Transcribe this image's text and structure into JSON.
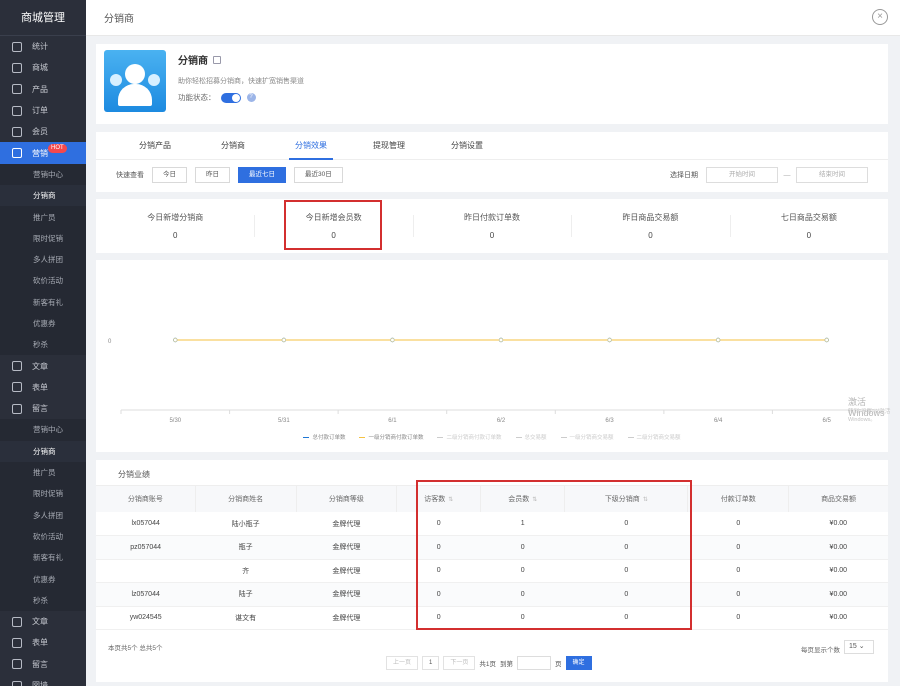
{
  "sidebar": {
    "title": "商城管理",
    "hot_badge": "HOT",
    "top_items": [
      {
        "label": "统计"
      },
      {
        "label": "商城"
      },
      {
        "label": "产品"
      },
      {
        "label": "订单"
      },
      {
        "label": "会员"
      },
      {
        "label": "营销"
      }
    ],
    "sub_items_1": [
      "营销中心",
      "分销商",
      "推广员",
      "限时促销",
      "多人拼团",
      "砍价活动",
      "新客有礼",
      "优惠券",
      "秒杀"
    ],
    "mid_items": [
      {
        "label": "文章"
      },
      {
        "label": "表单"
      },
      {
        "label": "留言"
      }
    ],
    "sub_items_2": [
      "营销中心",
      "分销商",
      "推广员",
      "限时促销",
      "多人拼团",
      "砍价活动",
      "新客有礼",
      "优惠券",
      "秒杀"
    ],
    "bottom_items": [
      {
        "label": "文章"
      },
      {
        "label": "表单"
      },
      {
        "label": "留言"
      },
      {
        "label": "図墙"
      }
    ]
  },
  "modal": {
    "title": "分销商",
    "close_icon": "×"
  },
  "plugin": {
    "name": "分销商",
    "description": "助你轻松招募分销商，快速扩宽销售渠道",
    "status_label": "功能状态：",
    "help": "?"
  },
  "tabs": [
    "分销产品",
    "分销商",
    "分销效果",
    "提现管理",
    "分销设置"
  ],
  "filter": {
    "label": "快速查看",
    "buttons": [
      "今日",
      "昨日",
      "最近七日",
      "最近30日"
    ],
    "date_label": "选择日期",
    "date_start": "开始时间",
    "date_sep": "—",
    "date_end": "结束时间"
  },
  "stats": [
    {
      "label": "今日新增分销商",
      "value": "0"
    },
    {
      "label": "今日新增会员数",
      "value": "0"
    },
    {
      "label": "昨日付款订单数",
      "value": "0"
    },
    {
      "label": "昨日商品交易额",
      "value": "0"
    },
    {
      "label": "七日商品交易额",
      "value": "0"
    }
  ],
  "chart_data": {
    "type": "line",
    "x": [
      "5/30",
      "5/31",
      "6/1",
      "6/2",
      "6/3",
      "6/4",
      "6/5"
    ],
    "y_tick": "0",
    "ylim": [
      0,
      1
    ],
    "grid": false,
    "legend_position": "bottom",
    "series": [
      {
        "name": "总付款订单数",
        "values": [
          0,
          0,
          0,
          0,
          0,
          0,
          0
        ],
        "color": "#1f77d4",
        "active": true
      },
      {
        "name": "一级分销商付款订单数",
        "values": [
          0,
          0,
          0,
          0,
          0,
          0,
          0
        ],
        "color": "#f5c242",
        "active": true
      },
      {
        "name": "二级分销商付款订单数",
        "values": [
          0,
          0,
          0,
          0,
          0,
          0,
          0
        ],
        "color": "#cccccc",
        "active": false
      },
      {
        "name": "总交易额",
        "values": [
          0,
          0,
          0,
          0,
          0,
          0,
          0
        ],
        "color": "#cccccc",
        "active": false
      },
      {
        "name": "一级分销商交易额",
        "values": [
          0,
          0,
          0,
          0,
          0,
          0,
          0
        ],
        "color": "#cccccc",
        "active": false
      },
      {
        "name": "二级分销商交易额",
        "values": [
          0,
          0,
          0,
          0,
          0,
          0,
          0
        ],
        "color": "#cccccc",
        "active": false
      }
    ]
  },
  "table": {
    "title": "分销业绩",
    "columns": [
      "分销商账号",
      "分销商姓名",
      "分销商等级",
      "访客数",
      "会员数",
      "下级分销商",
      "付款订单数",
      "商品交易额"
    ],
    "sort_icon": "⇅",
    "rows": [
      [
        "lx057044",
        "陆小瓶子",
        "金牌代理",
        "0",
        "1",
        "0",
        "0",
        "¥0.00"
      ],
      [
        "pz057044",
        "瓶子",
        "金牌代理",
        "0",
        "0",
        "0",
        "0",
        "¥0.00"
      ],
      [
        "",
        "齐",
        "金牌代理",
        "0",
        "0",
        "0",
        "0",
        "¥0.00"
      ],
      [
        "lz057044",
        "陆子",
        "金牌代理",
        "0",
        "0",
        "0",
        "0",
        "¥0.00"
      ],
      [
        "yw024545",
        "谌文有",
        "金牌代理",
        "0",
        "0",
        "0",
        "0",
        "¥0.00"
      ]
    ]
  },
  "pager": {
    "info": "本页共5个  总共5个",
    "prev": "上一页",
    "page": "1",
    "next": "下一页",
    "total_pages": "共1页",
    "goto": "到第",
    "page_unit": "页",
    "confirm": "确定",
    "size_label": "每页显示个数",
    "size_value": "15 ⌄"
  },
  "watermark": {
    "line1": "激活 Windows",
    "line2": "转到\"设置\"以激活 Windows。"
  }
}
